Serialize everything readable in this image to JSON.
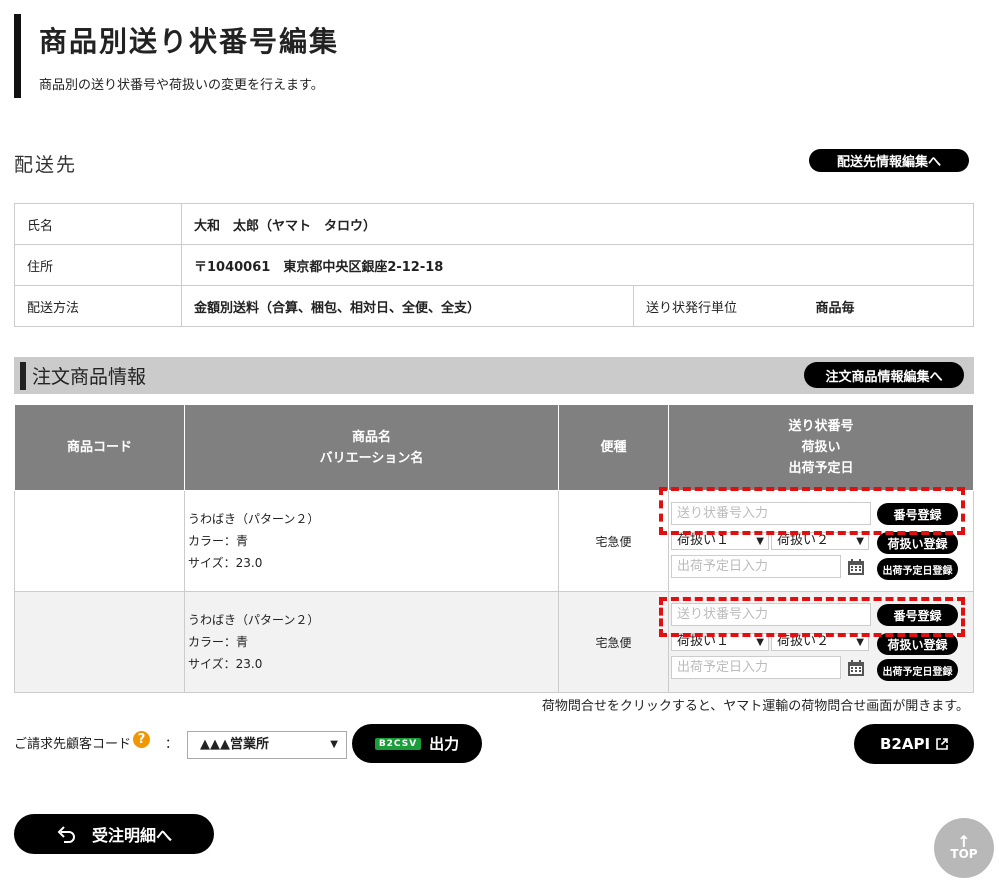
{
  "header": {
    "title": "商品別送り状番号編集",
    "subtitle": "商品別の送り状番号や荷扱いの変更を行えます。"
  },
  "destination": {
    "heading": "配送先",
    "edit_button": "配送先情報編集へ",
    "rows": {
      "name_label": "氏名",
      "name_value": "大和　太郎（ヤマト　タロウ）",
      "address_label": "住所",
      "address_value": "〒1040061　東京都中央区銀座2-12-18",
      "method_label": "配送方法",
      "method_value": "金額別送料（合算、梱包、相対日、全便、全支）",
      "unit_label": "送り状発行単位",
      "unit_value": "商品毎"
    }
  },
  "order": {
    "heading": "注文商品情報",
    "edit_button": "注文商品情報編集へ",
    "columns": {
      "code": "商品コード",
      "name_line1": "商品名",
      "name_line2": "バリエーション名",
      "ship_type": "便種",
      "ops_line1": "送り状番号",
      "ops_line2": "荷扱い",
      "ops_line3": "出荷予定日"
    },
    "rows": [
      {
        "code": "",
        "name": "うわばき（パターン２）",
        "color": "カラー：青",
        "size": "サイズ：23.0",
        "ship_type": "宅急便",
        "tracking_placeholder": "送り状番号入力",
        "tracking_button": "番号登録",
        "handling1": "荷扱い１",
        "handling2": "荷扱い２",
        "handling_button": "荷扱い登録",
        "date_placeholder": "出荷予定日入力",
        "date_button": "出荷予定日登録"
      },
      {
        "code": "",
        "name": "うわばき（パターン２）",
        "color": "カラー：青",
        "size": "サイズ：23.0",
        "ship_type": "宅急便",
        "tracking_placeholder": "送り状番号入力",
        "tracking_button": "番号登録",
        "handling1": "荷扱い１",
        "handling2": "荷扱い２",
        "handling_button": "荷扱い登録",
        "date_placeholder": "出荷予定日入力",
        "date_button": "出荷予定日登録"
      }
    ],
    "note": "荷物問合せをクリックすると、ヤマト運輸の荷物問合せ画面が開きます。"
  },
  "billing": {
    "label": "ご請求先顧客コード",
    "help": "?",
    "colon": "：",
    "selected": "▲▲▲営業所",
    "csv_badge": "B2CSV",
    "csv_button": "出力",
    "api_button": "B2API"
  },
  "footer": {
    "back_button": "受注明細へ",
    "top_label": "TOP"
  },
  "colors": {
    "accent_black": "#000000",
    "highlight_dash": "#e01010",
    "help_orange": "#f29600",
    "badge_green": "#1a9e3a"
  }
}
